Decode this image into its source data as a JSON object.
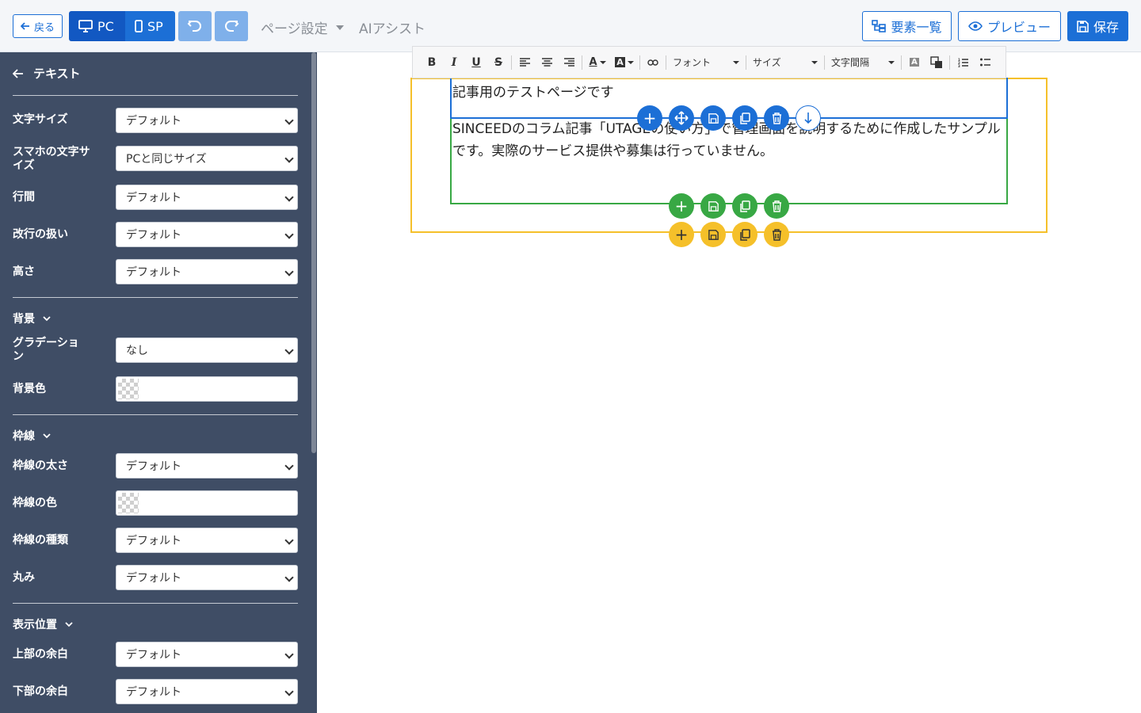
{
  "topbar": {
    "back_label": "戻る",
    "view_pc": "PC",
    "view_sp": "SP",
    "page_settings": "ページ設定",
    "ai_assist": "AIアシスト",
    "elements_list": "要素一覧",
    "preview": "プレビュー",
    "save": "保存"
  },
  "sidebar": {
    "title": "テキスト",
    "font_size": {
      "label": "文字サイズ",
      "value": "デフォルト"
    },
    "sp_font_size": {
      "label": "スマホの文字サイズ",
      "value": "PCと同じサイズ"
    },
    "line_height": {
      "label": "行間",
      "value": "デフォルト"
    },
    "line_break": {
      "label": "改行の扱い",
      "value": "デフォルト"
    },
    "height": {
      "label": "高さ",
      "value": "デフォルト"
    },
    "background_section": "背景",
    "gradation": {
      "label": "グラデーション",
      "value": "なし"
    },
    "bg_color": {
      "label": "背景色"
    },
    "border_section": "枠線",
    "border_width": {
      "label": "枠線の太さ",
      "value": "デフォルト"
    },
    "border_color": {
      "label": "枠線の色"
    },
    "border_style": {
      "label": "枠線の種類",
      "value": "デフォルト"
    },
    "radius": {
      "label": "丸み",
      "value": "デフォルト"
    },
    "position_section": "表示位置",
    "margin_top": {
      "label": "上部の余白",
      "value": "デフォルト"
    },
    "margin_bottom": {
      "label": "下部の余白",
      "value": "デフォルト"
    }
  },
  "editor": {
    "toolbar": {
      "font": "フォント",
      "size": "サイズ",
      "letter_spacing": "文字間隔"
    },
    "heading_text": "記事用のテストページです",
    "body_text": "SINCEEDのコラム記事「UTAGEの使い方」で管理画面を説明するために作成したサンプルです。実際のサービス提供や募集は行っていません。"
  },
  "colors": {
    "primary": "#1c6fd6",
    "green": "#38a844",
    "yellow": "#f5c02a",
    "sidebar_bg": "#3f4d65"
  }
}
